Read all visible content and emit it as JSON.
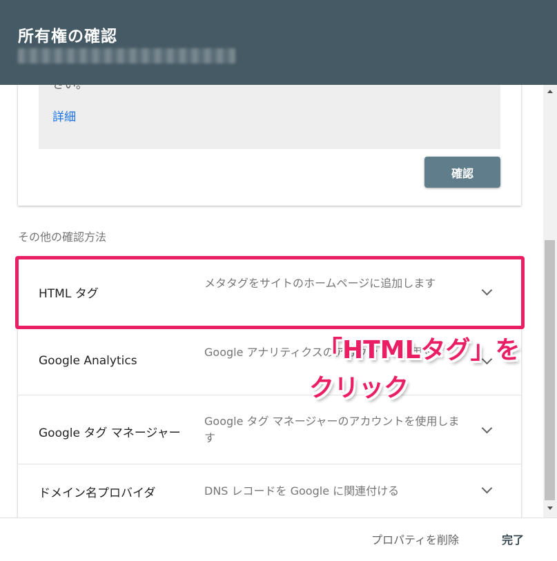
{
  "header": {
    "title": "所有権の確認"
  },
  "recommended": {
    "text_fragment": "さい。",
    "details_link": "詳細",
    "verify_button": "確認"
  },
  "other_methods": {
    "label": "その他の確認方法",
    "items": [
      {
        "name": "HTML タグ",
        "description": "メタタグをサイトのホームページに追加します"
      },
      {
        "name": "Google Analytics",
        "description": "Google アナリティクスのアカウントを使用する"
      },
      {
        "name": "Google タグ マネージャー",
        "description": "Google タグ マネージャーのアカウントを使用します"
      },
      {
        "name": "ドメイン名プロバイダ",
        "description": "DNS レコードを Google に関連付ける"
      }
    ]
  },
  "annotation": {
    "line1": "「HTMLタグ」を",
    "line2": "クリック",
    "color": "#e91e63"
  },
  "footer": {
    "delete_label": "プロパティを削除",
    "done_label": "完了"
  },
  "colors": {
    "header_bg": "#455a64",
    "button_bg": "#607d8b",
    "link": "#1a73e8",
    "highlight": "#e91e63"
  }
}
